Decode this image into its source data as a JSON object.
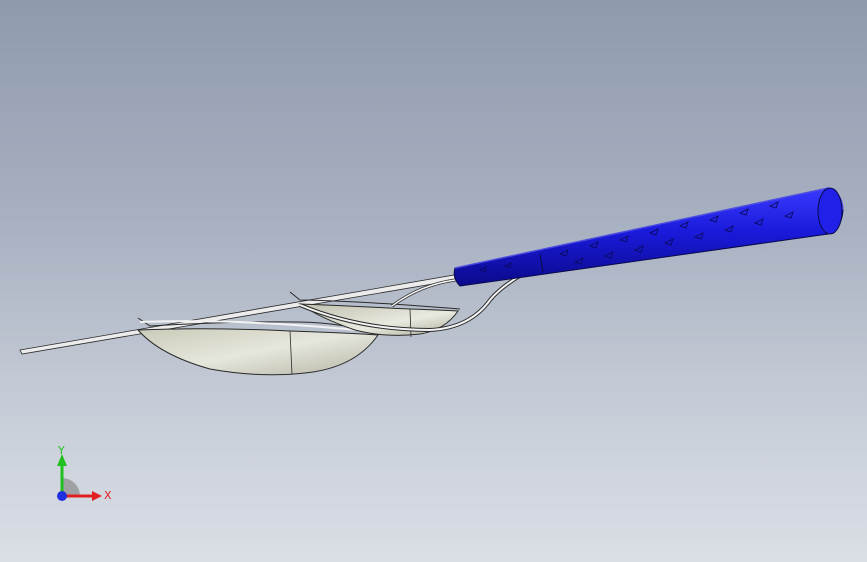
{
  "viewport": {
    "background_top": "#8f9aad",
    "background_bottom": "#dadee5"
  },
  "model": {
    "handle_color": "#1a1adb",
    "bowl_color": "#d9dad0",
    "wire_color": "#e8e8e8",
    "outline_color": "#2a2a2a"
  },
  "triad": {
    "x_label": "X",
    "y_label": "Y",
    "x_color": "#e02020",
    "y_color": "#20c020",
    "z_color": "#2030e0"
  }
}
